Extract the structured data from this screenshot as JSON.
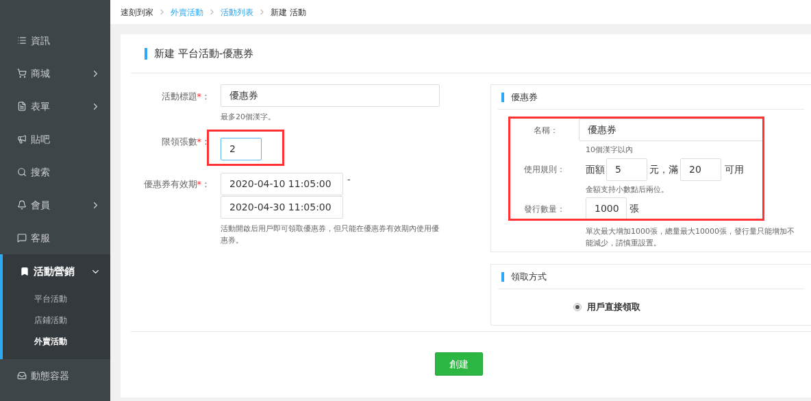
{
  "sidebar": {
    "items": [
      {
        "label": "資訊",
        "kind": "link",
        "selected": false
      },
      {
        "label": "商城",
        "kind": "group",
        "expanded": false,
        "selected": false
      },
      {
        "label": "表單",
        "kind": "group",
        "expanded": false,
        "selected": false
      },
      {
        "label": "貼吧",
        "kind": "link",
        "selected": false
      },
      {
        "label": "搜索",
        "kind": "link",
        "selected": false
      },
      {
        "label": "會員",
        "kind": "group",
        "expanded": false,
        "selected": false
      },
      {
        "label": "客服",
        "kind": "link",
        "selected": false
      },
      {
        "label": "活動營銷",
        "kind": "group",
        "expanded": true,
        "selected": true,
        "children": [
          {
            "label": "平台活動",
            "selected": false
          },
          {
            "label": "店鋪活動",
            "selected": false
          },
          {
            "label": "外賣活動",
            "selected": true
          }
        ]
      },
      {
        "label": "動態容器",
        "kind": "link",
        "selected": false
      }
    ]
  },
  "breadcrumb": [
    {
      "label": "速刻到家",
      "kind": "text"
    },
    {
      "label": "外賣活動",
      "kind": "link"
    },
    {
      "label": "活動列表",
      "kind": "link"
    },
    {
      "label": "新建 活動",
      "kind": "text"
    }
  ],
  "page_title": "新建 平台活動-優惠券",
  "form": [
    {
      "kind": "text",
      "label": "活動標題",
      "required_mark": "*",
      "colon": "：",
      "value": "優惠券",
      "hint": "最多20個漢字。"
    },
    {
      "kind": "short",
      "label": "限領張數",
      "required_mark": "*",
      "colon": "：",
      "value": "2",
      "focused": true,
      "highlighted": true
    },
    {
      "kind": "daterange",
      "label": "優惠券有效期",
      "required_mark": "*",
      "colon": "：",
      "values": [
        "2020-04-10 11:05:00",
        "2020-04-30 11:05:00"
      ],
      "separator": "-",
      "hint": "活動開啟后用戶即可領取優惠券，但只能在優惠券有效期內使用優惠券。"
    }
  ],
  "coupon_panel": {
    "title": "優惠券",
    "highlighted": true,
    "name": {
      "label": "名稱：",
      "value": "優惠券",
      "hint": "10個漢字以內"
    },
    "rule": {
      "label": "使用規則：",
      "prefix": "面額",
      "amount": "5",
      "middle": "元，滿",
      "threshold": "20",
      "suffix": "可用",
      "hint": "金額支持小數點后兩位。"
    },
    "quantity": {
      "label": "發行數量：",
      "value": "1000",
      "unit": "張",
      "hint": "單次最大增加1000張，總量最大10000張，發行量只能增加不能減少，請慎重設置。"
    }
  },
  "claim_panel": {
    "title": "領取方式",
    "options": [
      {
        "label": "用戶直接領取",
        "selected": true
      }
    ]
  },
  "submit_button": "創建"
}
